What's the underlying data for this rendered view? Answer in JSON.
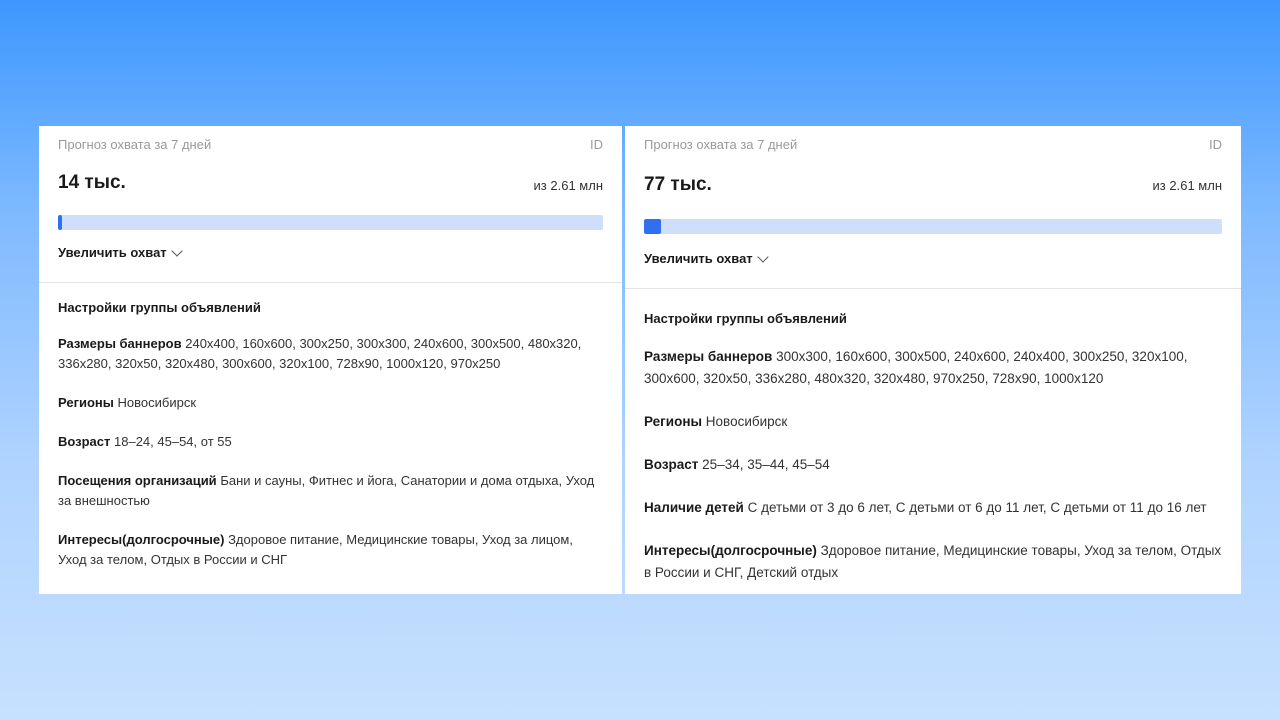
{
  "panels": [
    {
      "forecast_label": "Прогноз охвата за 7 дней",
      "id_label": "ID",
      "reach_value": "14 тыс.",
      "reach_total": "из 2.61 млн",
      "progress_percent": 0.54,
      "expand_label": "Увеличить охват",
      "settings_title": "Настройки группы объявлений",
      "settings": [
        {
          "key": "Размеры баннеров",
          "value": "240x400, 160x600, 300x250, 300x300, 240x600, 300x500, 480x320, 336x280, 320x50, 320x480, 300x600, 320x100, 728x90, 1000x120, 970x250"
        },
        {
          "key": "Регионы",
          "value": "Новосибирск"
        },
        {
          "key": "Возраст",
          "value": "18–24, 45–54, от 55"
        },
        {
          "key": "Посещения организаций",
          "value": "Бани и сауны, Фитнес и йога, Санатории и дома отдыха, Уход за внешностью"
        },
        {
          "key": "Интересы(долгосрочные)",
          "value": "Здоровое питание, Медицинские товары, Уход за лицом, Уход за телом, Отдых в России и СНГ"
        }
      ]
    },
    {
      "forecast_label": "Прогноз охвата за 7 дней",
      "id_label": "ID",
      "reach_value": "77 тыс.",
      "reach_total": "из 2.61 млн",
      "progress_percent": 2.95,
      "expand_label": "Увеличить охват",
      "settings_title": "Настройки группы объявлений",
      "settings": [
        {
          "key": "Размеры баннеров",
          "value": "300x300, 160x600, 300x500, 240x600, 240x400, 300x250, 320x100, 300x600, 320x50, 336x280, 480x320, 320x480, 970x250, 728x90, 1000x120"
        },
        {
          "key": "Регионы",
          "value": "Новосибирск"
        },
        {
          "key": "Возраст",
          "value": "25–34, 35–44, 45–54"
        },
        {
          "key": "Наличие детей",
          "value": "С детьми от 3 до 6 лет, С детьми от 6 до 11 лет, С детьми от 11 до 16 лет"
        },
        {
          "key": "Интересы(долгосрочные)",
          "value": "Здоровое питание, Медицинские товары, Уход за телом, Отдых в России и СНГ, Детский отдых"
        }
      ]
    }
  ]
}
